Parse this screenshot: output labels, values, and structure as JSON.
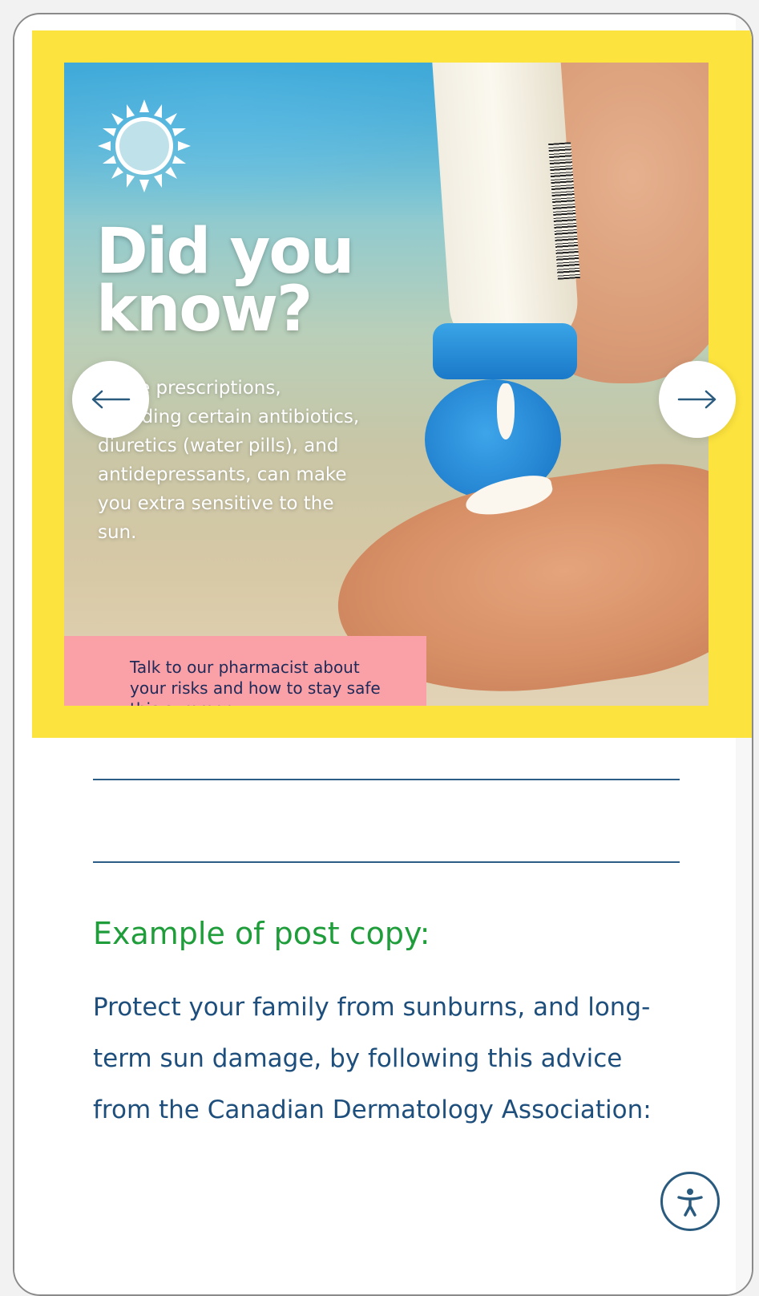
{
  "promo": {
    "headline": "Did you know?",
    "body": "Some prescriptions, including certain antibiotics, diuretics (water pills), and antidepressants, can make you extra sensitive to the sun.",
    "cta": "Talk to our pharmacist about your risks and how to stay safe this summer.",
    "background_color": "#fde33d",
    "cta_color": "#f9a1a6",
    "icons": [
      "sun-icon",
      "arrow-left-icon",
      "arrow-right-icon"
    ]
  },
  "section": {
    "heading": "Example of post copy:",
    "body": "Protect your family from sunburns, and long-term sun damage, by following this advice from the Canadian Dermatology Association:",
    "heading_color": "#1f9d3a",
    "body_color": "#1e4f7c"
  },
  "accessibility": {
    "icon": "accessibility-icon"
  }
}
